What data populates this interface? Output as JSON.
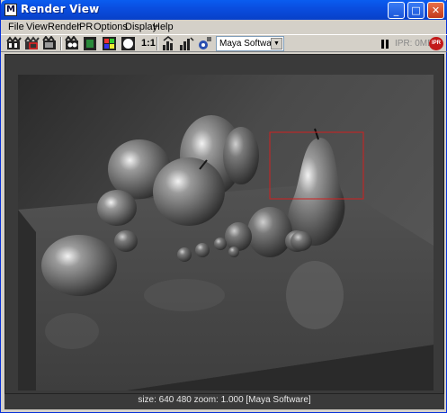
{
  "window": {
    "title": "Render View",
    "app_icon_letter": "M",
    "controls": {
      "minimize": "_",
      "maximize": "□",
      "close": "✕"
    }
  },
  "menubar": {
    "items": [
      "File",
      "View",
      "Render",
      "IPR",
      "Options",
      "Display",
      "Help"
    ]
  },
  "toolbar": {
    "icons": [
      "redo-render-icon",
      "render-region-icon",
      "snapshot-icon",
      "ipr-render-icon",
      "ipr-region-icon",
      "display-rgb-icon",
      "display-alpha-icon",
      "keep-image-icon",
      "remove-image-icon",
      "render-globals-icon"
    ],
    "ratio_label": "1:1",
    "renderer": {
      "selected": "Maya Software"
    },
    "ipr_status": "IPR: 0MB",
    "ipr_badge": "IPR"
  },
  "status": {
    "text": "size:  640  480 zoom: 1.000  [Maya Software]"
  },
  "colors": {
    "title_bar": "#0a4ee0",
    "window_bg": "#d4d0c8",
    "viewport_bg": "#3a3a3a",
    "region_marquee": "#d02020"
  }
}
